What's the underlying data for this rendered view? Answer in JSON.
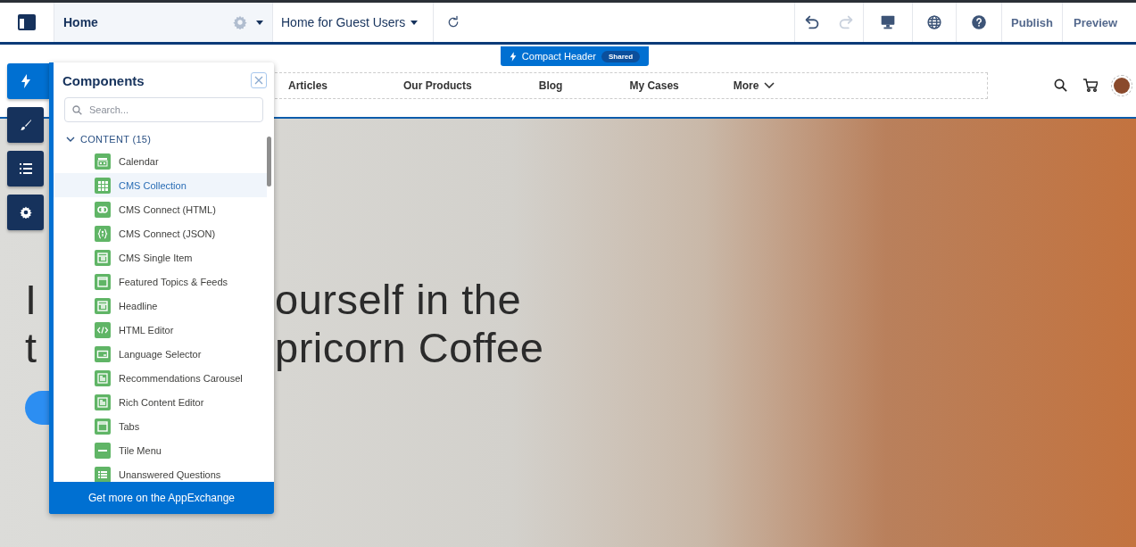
{
  "top_bar": {
    "page": "Home",
    "page_variant": "Home for Guest Users",
    "tools": [
      {
        "kind": "undo",
        "disabled": false
      },
      {
        "kind": "redo",
        "disabled": true
      },
      {
        "kind": "device",
        "disabled": false
      },
      {
        "kind": "globe",
        "disabled": false
      },
      {
        "kind": "help",
        "disabled": false
      }
    ],
    "actions": [
      "Publish",
      "Preview"
    ]
  },
  "header_badge": {
    "label": "Compact Header",
    "tag": "Shared"
  },
  "nav": {
    "items": [
      "Articles",
      "Our Products",
      "Blog",
      "My Cases",
      "More"
    ]
  },
  "side_rail": [
    {
      "kind": "components",
      "selected": true
    },
    {
      "kind": "theme",
      "selected": false
    },
    {
      "kind": "pages",
      "selected": false
    },
    {
      "kind": "settings",
      "selected": false
    }
  ],
  "components_panel": {
    "title": "Components",
    "search": {
      "placeholder": "Search..."
    },
    "group": {
      "label": "CONTENT (15)",
      "expanded": true,
      "items": [
        {
          "label": "Calendar",
          "kind": "calendar",
          "selected": false
        },
        {
          "label": "CMS Collection",
          "kind": "grid",
          "selected": true
        },
        {
          "label": "CMS Connect (HTML)",
          "kind": "rings",
          "selected": false
        },
        {
          "label": "CMS Connect (JSON)",
          "kind": "braces",
          "selected": false
        },
        {
          "label": "CMS Single Item",
          "kind": "card",
          "selected": false
        },
        {
          "label": "Featured Topics & Feeds",
          "kind": "page",
          "selected": false
        },
        {
          "label": "Headline",
          "kind": "card",
          "selected": false
        },
        {
          "label": "HTML Editor",
          "kind": "code",
          "selected": false
        },
        {
          "label": "Language Selector",
          "kind": "window",
          "selected": false
        },
        {
          "label": "Recommendations Carousel",
          "kind": "doc",
          "selected": false
        },
        {
          "label": "Rich Content Editor",
          "kind": "doc",
          "selected": false
        },
        {
          "label": "Tabs",
          "kind": "page",
          "selected": false
        },
        {
          "label": "Tile Menu",
          "kind": "bar",
          "selected": false
        },
        {
          "label": "Unanswered Questions",
          "kind": "list",
          "selected": false
        }
      ]
    },
    "footer": "Get more on the AppExchange"
  },
  "hero": {
    "headline": [
      {
        "left": "I",
        "right": "ourself in the"
      },
      {
        "left": "t",
        "right": "pricorn Coffee"
      }
    ]
  }
}
